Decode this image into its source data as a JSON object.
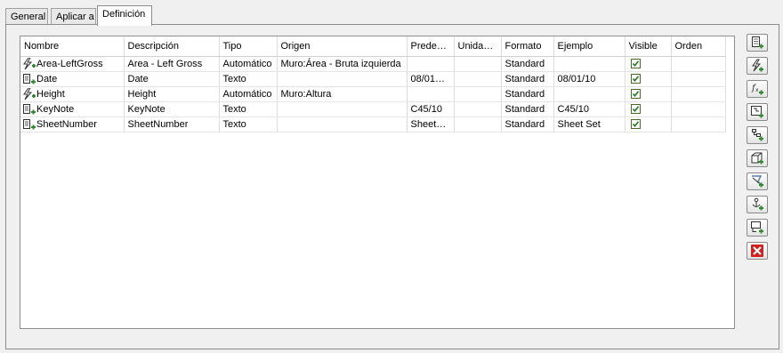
{
  "tabs": [
    "General",
    "Aplicar a",
    "Definición"
  ],
  "active_tab": 2,
  "columns": [
    "Nombre",
    "Descripción",
    "Tipo",
    "Origen",
    "Prede…",
    "Unida…",
    "Formato",
    "Ejemplo",
    "Visible",
    "Orden"
  ],
  "rows": [
    {
      "icon": "lightning-formula-icon",
      "name": "Area-LeftGross",
      "description": "Area - Left Gross",
      "type": "Automático",
      "source": "Muro:Área - Bruta izquierda",
      "default": "",
      "units": "",
      "format": "Standard",
      "example": "",
      "visible": true,
      "order": ""
    },
    {
      "icon": "text-property-icon",
      "name": "Date",
      "description": "Date",
      "type": "Texto",
      "source": "",
      "default": "08/01…",
      "units": "",
      "format": "Standard",
      "example": "08/01/10",
      "visible": true,
      "order": ""
    },
    {
      "icon": "lightning-formula-icon",
      "name": "Height",
      "description": "Height",
      "type": "Automático",
      "source": "Muro:Altura",
      "default": "",
      "units": "",
      "format": "Standard",
      "example": "",
      "visible": true,
      "order": ""
    },
    {
      "icon": "text-property-icon",
      "name": "KeyNote",
      "description": "KeyNote",
      "type": "Texto",
      "source": "",
      "default": "C45/10",
      "units": "",
      "format": "Standard",
      "example": "C45/10",
      "visible": true,
      "order": ""
    },
    {
      "icon": "text-property-icon",
      "name": "SheetNumber",
      "description": "SheetNumber",
      "type": "Texto",
      "source": "",
      "default": "Sheet…",
      "units": "",
      "format": "Standard",
      "example": "Sheet Set",
      "visible": true,
      "order": ""
    }
  ],
  "toolbar": [
    {
      "icon": "add-text-property-icon"
    },
    {
      "icon": "add-auto-property-icon"
    },
    {
      "icon": "add-formula-property-icon"
    },
    {
      "icon": "add-anchor-property-icon"
    },
    {
      "icon": "add-classification-property-icon"
    },
    {
      "icon": "add-material-property-icon"
    },
    {
      "icon": "add-graphic-property-icon"
    },
    {
      "icon": "add-location-property-icon"
    },
    {
      "icon": "add-project-property-icon"
    },
    {
      "icon": "delete-icon"
    }
  ],
  "colors": {
    "accent_green": "#2e8b2e",
    "delete_red": "#d02020"
  }
}
